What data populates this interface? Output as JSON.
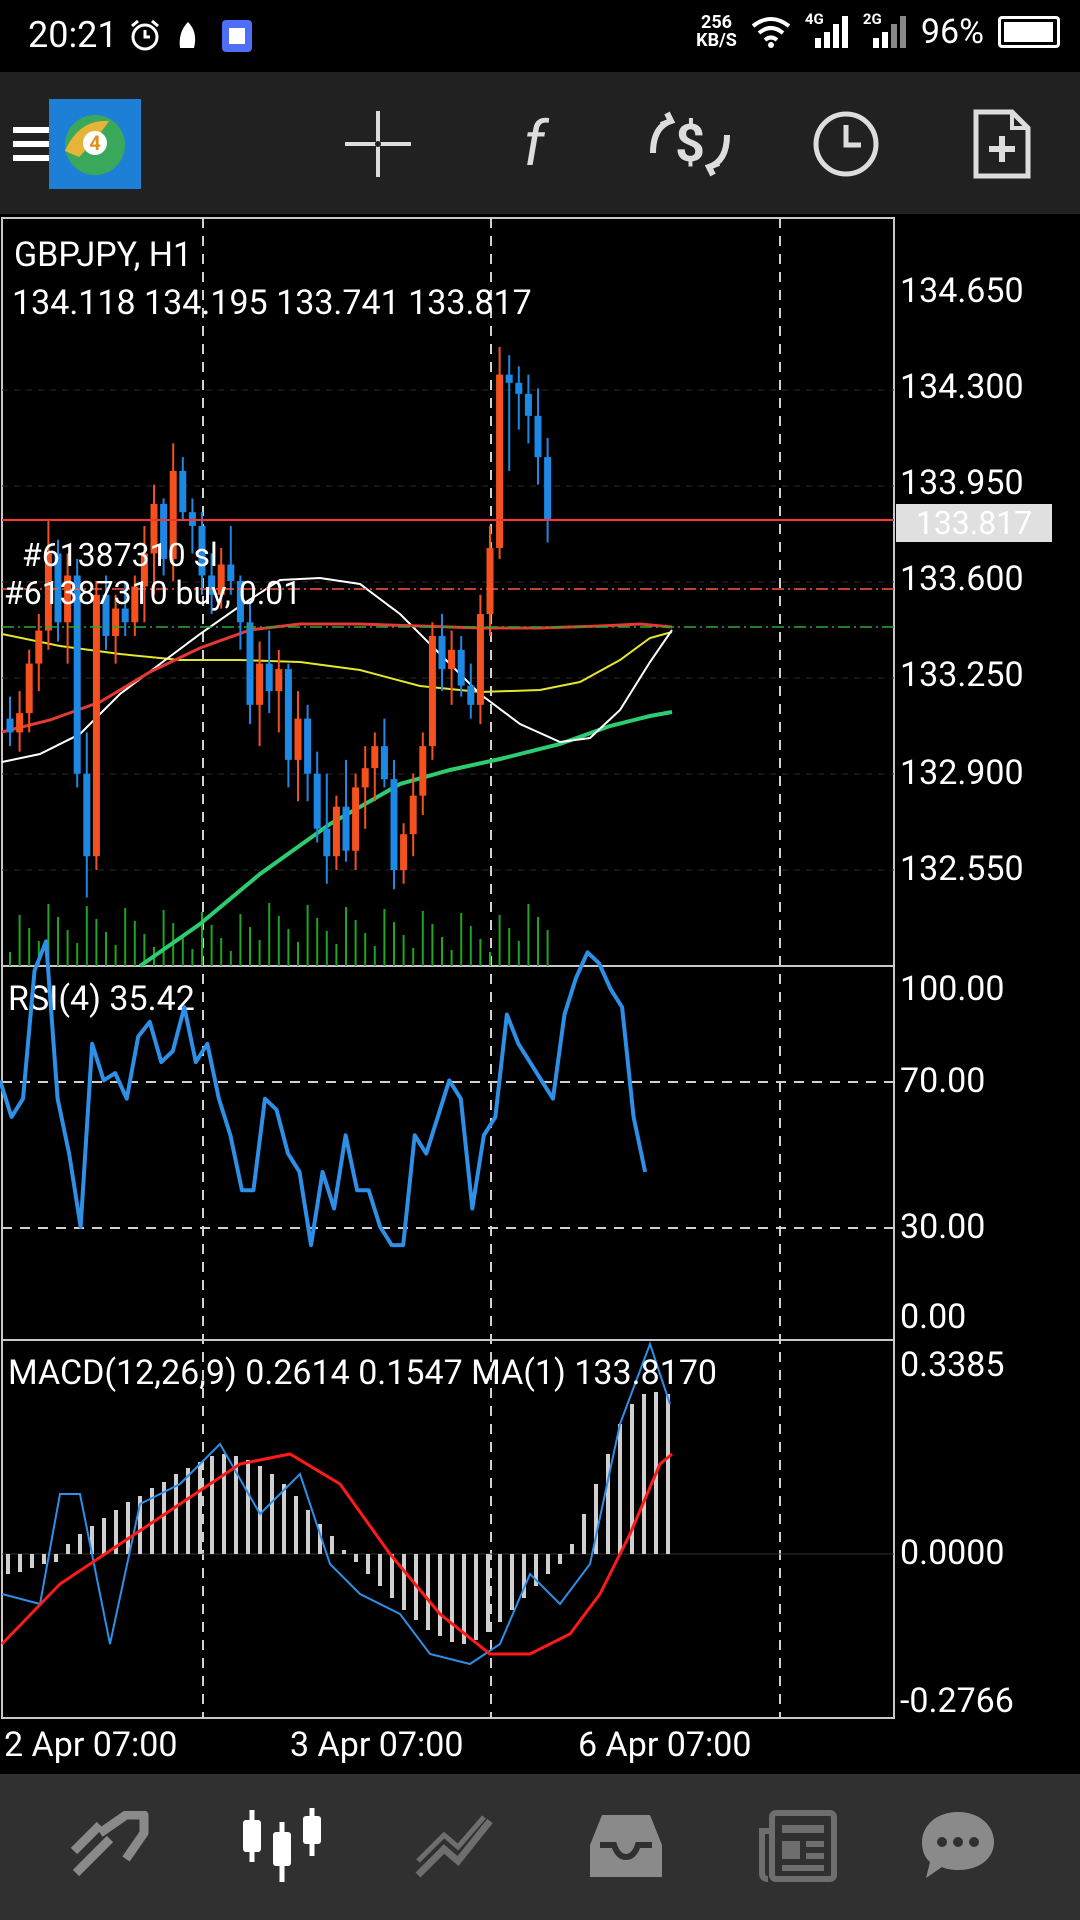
{
  "status_bar": {
    "time": "20:21",
    "net_speed_value": "256",
    "net_speed_unit": "KB/S",
    "signal_1": "4G",
    "signal_2": "2G",
    "battery": "96%"
  },
  "toolbar": {
    "items": [
      "menu-icon",
      "mt4-logo",
      "crosshair-icon",
      "indicators-icon",
      "trade-icon",
      "timeframe-clock-icon",
      "new-order-icon"
    ]
  },
  "chart": {
    "symbol_line": "GBPJPY, H1",
    "ohlc_line": "134.118 134.195 133.741 133.817",
    "current_price": "133.817",
    "price_ticks": [
      "134.650",
      "134.300",
      "133.950",
      "133.600",
      "133.250",
      "132.900",
      "132.550"
    ],
    "order_label_1": "#61387310 sl",
    "order_label_2": "#61387310 buy, 0.01",
    "rsi_label": "RSI(4) 35.42",
    "rsi_ticks": [
      "100.00",
      "70.00",
      "30.00",
      "0.00"
    ],
    "macd_label": "MACD(12,26,9) 0.2614 0.1547 MA(1) 133.8170",
    "macd_ticks": [
      "0.3385",
      "0.0000",
      "-0.2766"
    ],
    "time_labels": [
      "2 Apr 07:00",
      "3 Apr 07:00",
      "6 Apr 07:00"
    ],
    "colors": {
      "bull": "#f4511e",
      "bear": "#1e88e5",
      "price_line": "#ff3333",
      "rsi": "#2d8fe6",
      "macd_signal": "#ff1a1a",
      "ma_red": "#e53935",
      "ma_yellow": "#e6e62e",
      "ma_white": "#ffffff",
      "ma_green": "#2ecc71",
      "volume": "#1fa51f"
    }
  },
  "bottom_nav": {
    "items": [
      "quotes-icon",
      "chart-icon",
      "trade-icon",
      "history-icon",
      "news-icon",
      "chat-icon"
    ],
    "active": "chart-icon"
  }
}
